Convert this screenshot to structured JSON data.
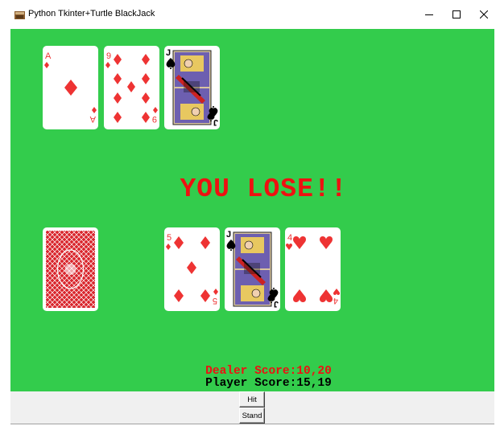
{
  "window": {
    "title": "Python Tkinter+Turtle BlackJack",
    "controls": [
      "minimize",
      "maximize",
      "close"
    ]
  },
  "colors": {
    "table": "#33cc4c",
    "red_text": "#ee1111",
    "black_text": "#000000",
    "card_back": "#d9242b"
  },
  "dealer": {
    "cards": [
      {
        "rank": "A",
        "suit": "diamonds",
        "symbol": "♦",
        "color": "#ee3333"
      },
      {
        "rank": "9",
        "suit": "diamonds",
        "symbol": "♦",
        "color": "#ee3333"
      },
      {
        "rank": "J",
        "suit": "spades",
        "symbol": "♠",
        "color": "#000000",
        "face": true
      }
    ]
  },
  "player": {
    "hidden_card": "card-back",
    "cards": [
      {
        "rank": "5",
        "suit": "diamonds",
        "symbol": "♦",
        "color": "#ee3333"
      },
      {
        "rank": "J",
        "suit": "spades",
        "symbol": "♠",
        "color": "#000000",
        "face": true
      },
      {
        "rank": "4",
        "suit": "hearts",
        "symbol": "♥",
        "color": "#ee3333"
      }
    ]
  },
  "result": {
    "message": "YOU LOSE!!"
  },
  "scores": {
    "dealer": "Dealer Score:10,20",
    "player": "Player Score:15,19"
  },
  "buttons": {
    "hit": "Hit",
    "stand": "Stand"
  }
}
